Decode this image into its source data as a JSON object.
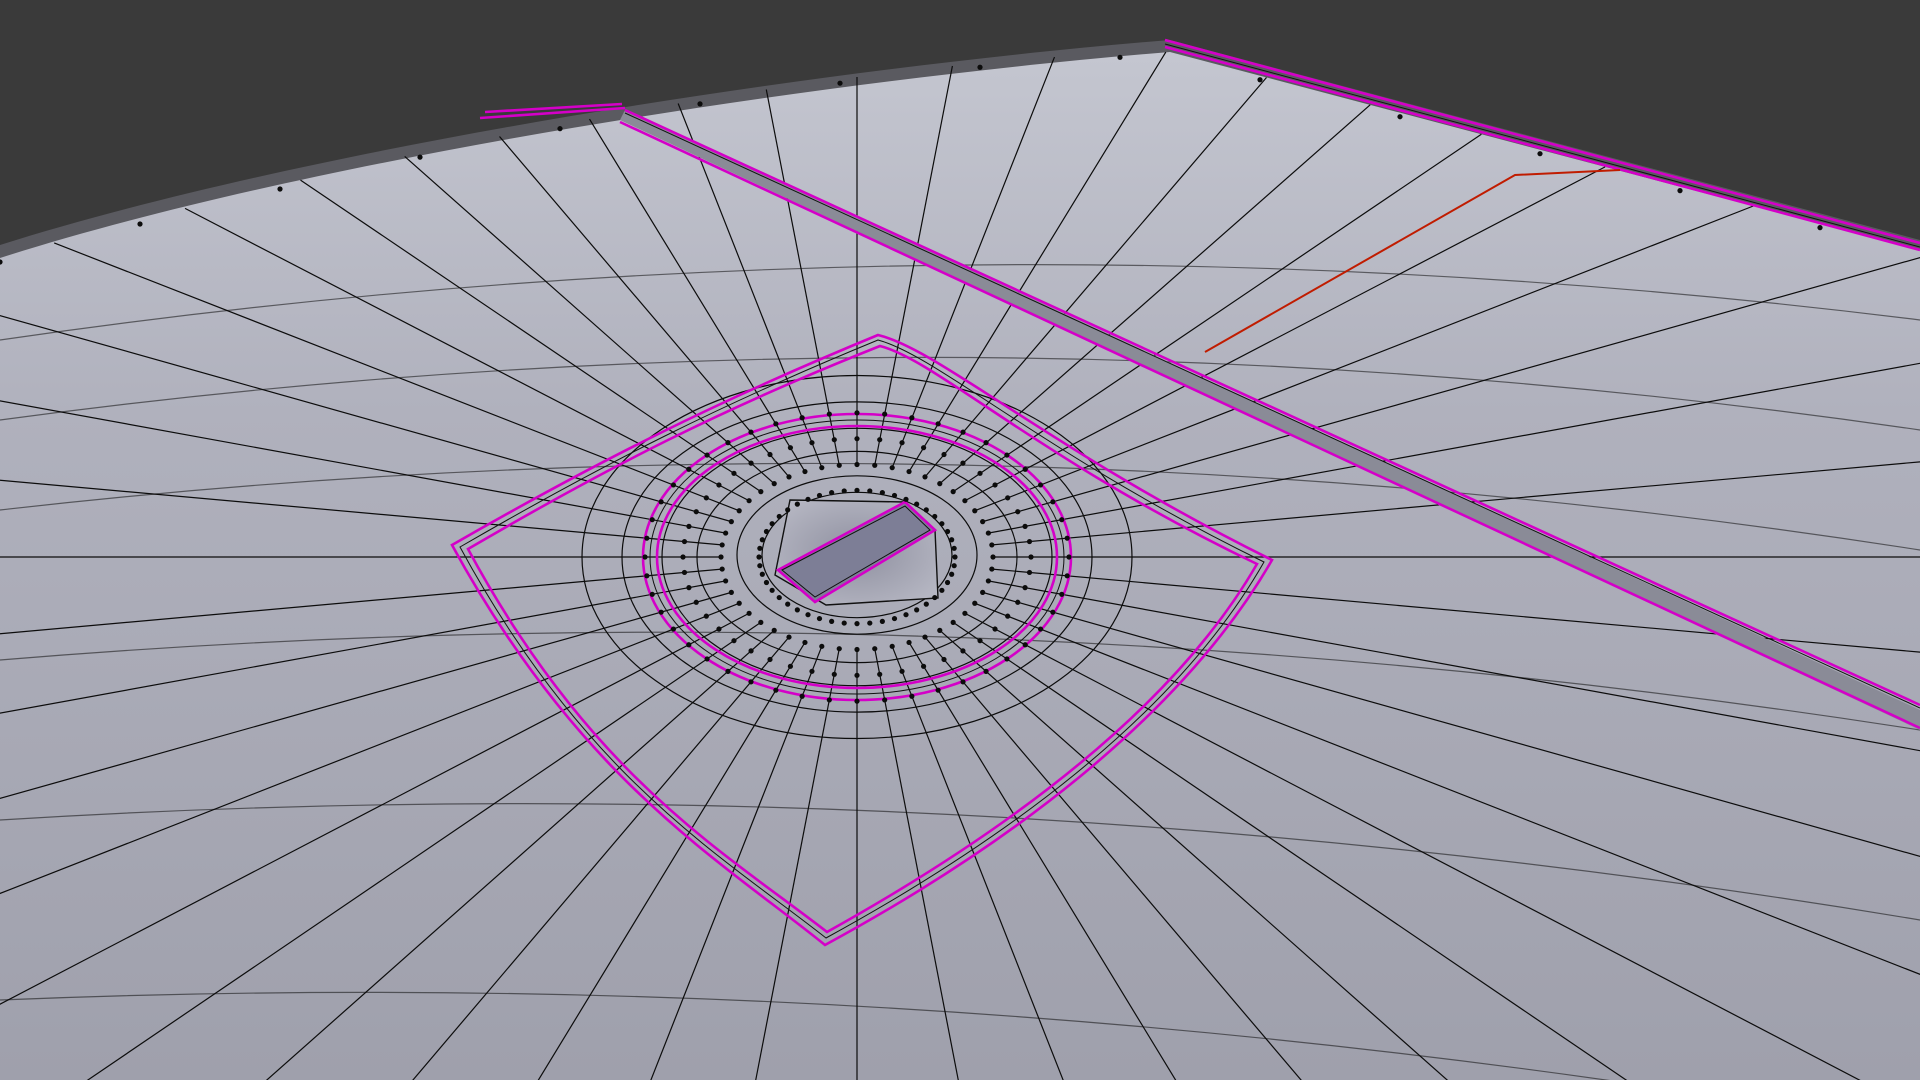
{
  "viewport": {
    "background_color": "#3a3a3a",
    "surface_color": "#a7a8b5",
    "wire_color": "#0c0c0c",
    "seam_color": "#d400c8",
    "sharp_edge_color": "#c01c00"
  },
  "mesh": {
    "object": "mesh-surface",
    "features": [
      "curved-plane",
      "square-inset-patch",
      "circular-loop-rings",
      "rectangular-hole",
      "groove-strip",
      "uv-seam-edges",
      "sharp-edge-marker"
    ]
  }
}
